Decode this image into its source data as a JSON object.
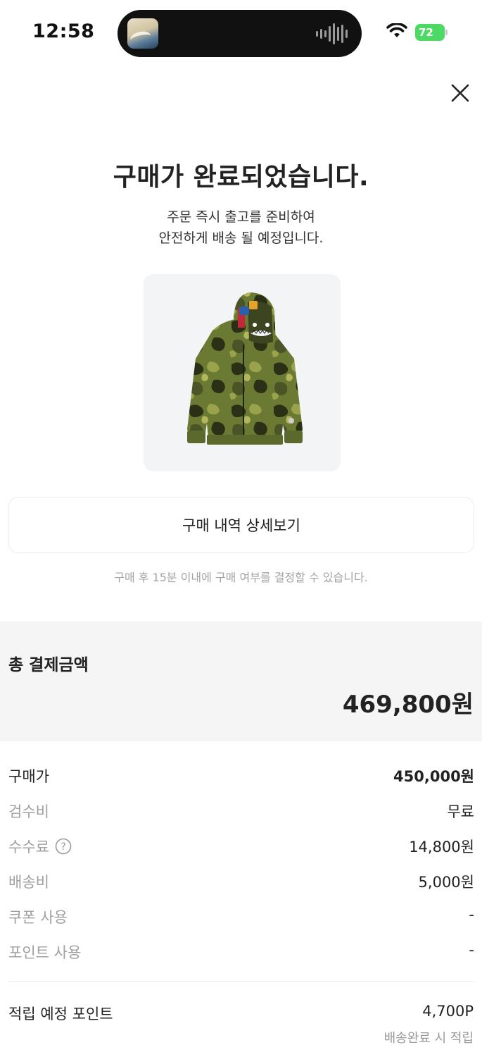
{
  "status_bar": {
    "time": "12:58",
    "battery": "72",
    "battery_color": "#4cd964"
  },
  "icons": {
    "close": "close-icon",
    "help": "question-circle-icon",
    "wifi": "wifi-icon"
  },
  "confirmation": {
    "title": "구매가 완료되었습니다.",
    "subtitle_line1": "주문 즉시 출고를 준비하여",
    "subtitle_line2": "안전하게 배송 될 예정입니다."
  },
  "actions": {
    "detail_button": "구매 내역 상세보기"
  },
  "notice": "구매 후 15분 이내에 구매 여부를 결정할 수 있습니다.",
  "total": {
    "label": "총 결제금액",
    "amount": "469,800원"
  },
  "breakdown": {
    "purchase_price_label": "구매가",
    "purchase_price_value": "450,000원",
    "inspection_fee_label": "검수비",
    "inspection_fee_value": "무료",
    "commission_label": "수수료",
    "commission_value": "14,800원",
    "shipping_label": "배송비",
    "shipping_value": "5,000원",
    "coupon_label": "쿠폰 사용",
    "coupon_value": "-",
    "point_use_label": "포인트 사용",
    "point_use_value": "-"
  },
  "points": {
    "label": "적립 예정 포인트",
    "value": "4,700P",
    "note": "배송완료 시 적립"
  }
}
